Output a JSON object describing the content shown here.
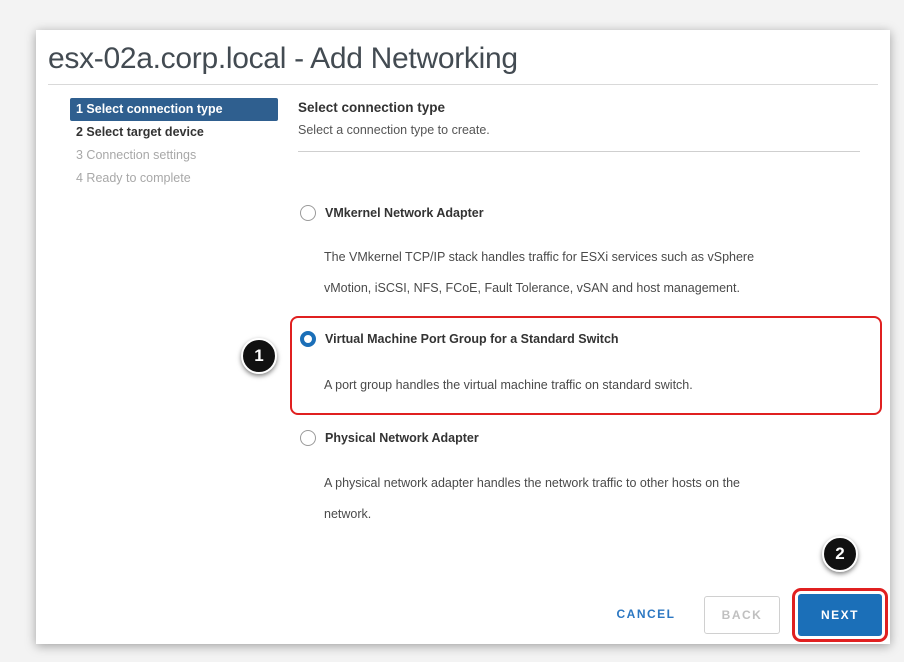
{
  "dialog": {
    "title": "esx-02a.corp.local - Add Networking"
  },
  "steps": [
    {
      "label": "1 Select connection type",
      "state": "active"
    },
    {
      "label": "2 Select target device",
      "state": "normal"
    },
    {
      "label": "3 Connection settings",
      "state": "disabled"
    },
    {
      "label": "4 Ready to complete",
      "state": "disabled"
    }
  ],
  "content": {
    "title": "Select connection type",
    "subtitle": "Select a connection type to create."
  },
  "options": [
    {
      "label": "VMkernel Network Adapter",
      "desc_lines": [
        "The VMkernel TCP/IP stack handles traffic for ESXi services such as vSphere",
        "vMotion, iSCSI, NFS, FCoE, Fault Tolerance, vSAN and host management."
      ],
      "selected": false
    },
    {
      "label": "Virtual Machine Port Group for a Standard Switch",
      "desc_lines": [
        "A port group handles the virtual machine traffic on standard switch."
      ],
      "selected": true
    },
    {
      "label": "Physical Network Adapter",
      "desc_lines": [
        "A physical network adapter handles the network traffic to other hosts on the",
        "network."
      ],
      "selected": false
    }
  ],
  "annotations": {
    "badge1": "1",
    "badge2": "2",
    "highlight_color": "#e02020"
  },
  "buttons": {
    "cancel": "CANCEL",
    "back": "BACK",
    "next": "NEXT"
  },
  "colors": {
    "accent": "#1b6fb8",
    "step_active_bg": "#2f5f8f"
  }
}
